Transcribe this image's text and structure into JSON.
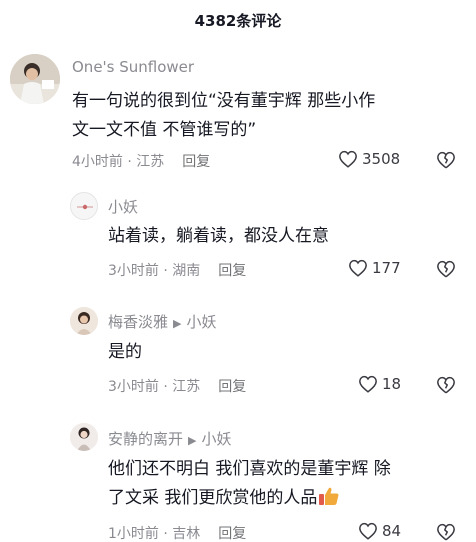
{
  "header": {
    "title": "4382条评论"
  },
  "comment": {
    "author": "One's Sunflower",
    "text_line1": "有一句说的很到位“没有董宇辉  那些小作",
    "text_line2": "文一文不值 不管谁写的”",
    "time_location": "4小时前 · 江苏",
    "reply_label": "回复",
    "likes": "3508"
  },
  "replies": [
    {
      "author": "小妖",
      "reply_to": "",
      "text_line1": "站着读，躺着读，都没人在意",
      "text_line2": "",
      "time_location": "3小时前 · 湖南",
      "reply_label": "回复",
      "likes": "177"
    },
    {
      "author": "梅香淡雅",
      "reply_to": "小妖",
      "text_line1": "是的",
      "text_line2": "",
      "time_location": "3小时前 · 江苏",
      "reply_label": "回复",
      "likes": "18"
    },
    {
      "author": "安静的离开",
      "reply_to": "小妖",
      "text_line1": "他们还不明白  我们喜欢的是董宇辉  除",
      "text_line2": "了文采  我们更欣赏他的人品",
      "time_location": "1小时前 · 吉林",
      "reply_label": "回复",
      "likes": "84"
    }
  ],
  "icons": {
    "like": "heart-outline-icon",
    "dislike": "broken-heart-icon",
    "thumbs_up": "thumbs-up-emoji-icon",
    "reply_arrow": "triangle-right-icon"
  },
  "colors": {
    "text": "#161823",
    "muted": "#8a8b91",
    "thumb": "#f2a93b"
  }
}
